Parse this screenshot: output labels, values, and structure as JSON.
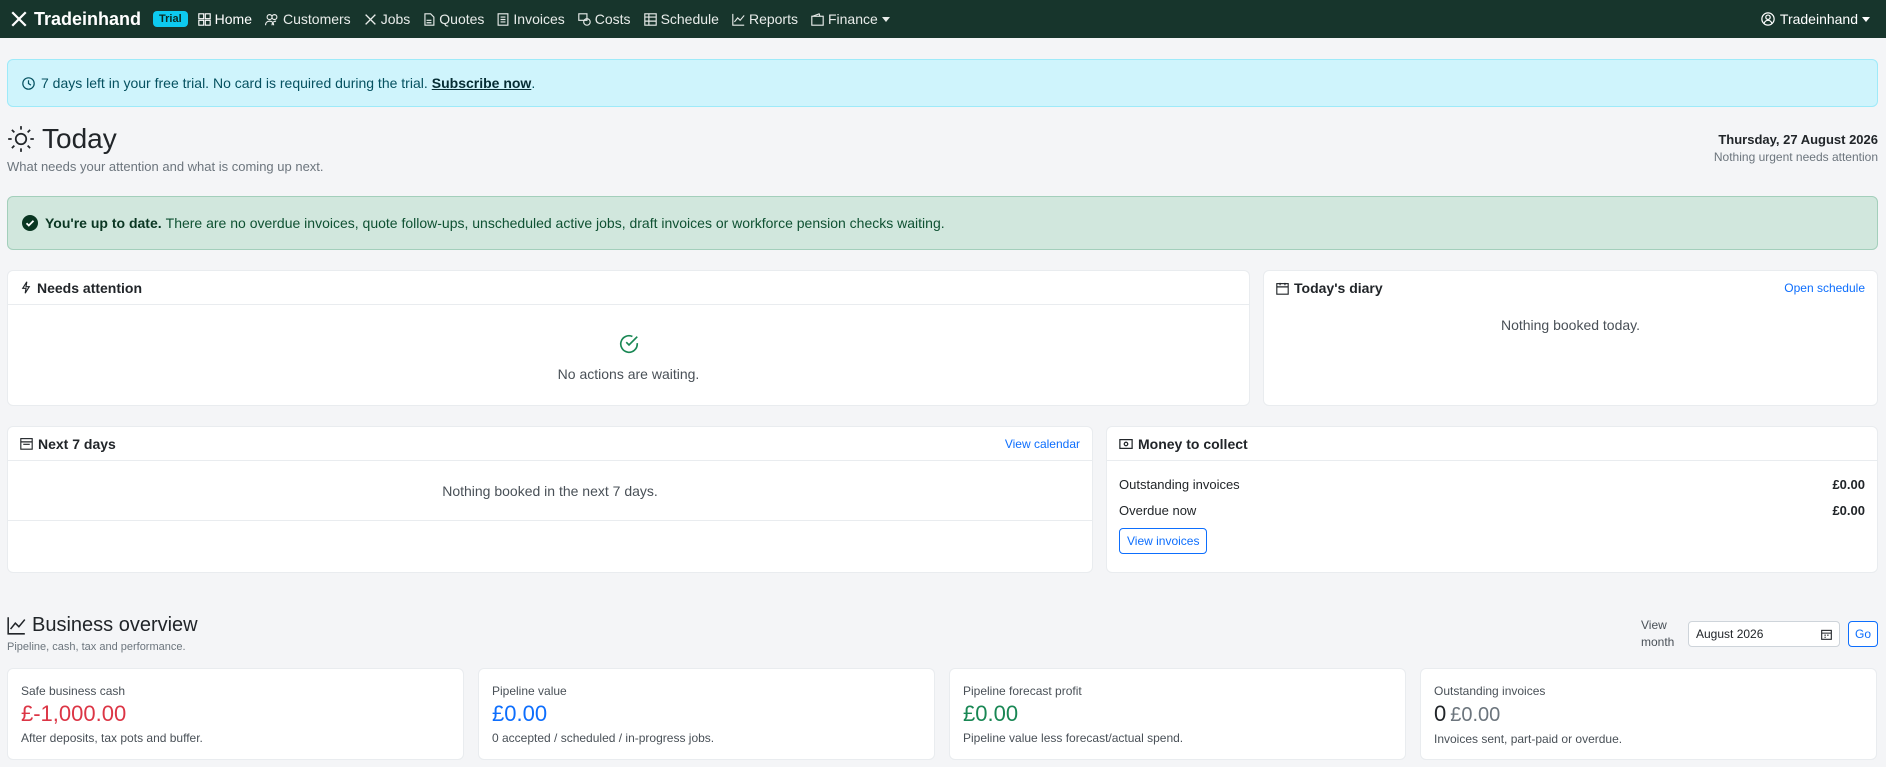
{
  "navbar": {
    "brand": "Tradeinhand",
    "trial_badge": "Trial",
    "items": [
      {
        "label": "Home",
        "icon": "grid-icon"
      },
      {
        "label": "Customers",
        "icon": "people-icon"
      },
      {
        "label": "Jobs",
        "icon": "tools-icon"
      },
      {
        "label": "Quotes",
        "icon": "document-icon"
      },
      {
        "label": "Invoices",
        "icon": "receipt-icon"
      },
      {
        "label": "Costs",
        "icon": "coins-icon"
      },
      {
        "label": "Schedule",
        "icon": "table-icon"
      },
      {
        "label": "Reports",
        "icon": "chart-line-icon"
      },
      {
        "label": "Finance",
        "icon": "wallet-icon"
      }
    ],
    "user": "Tradeinhand"
  },
  "trial_alert": {
    "text": "7 days left in your free trial. No card is required during the trial.",
    "link": "Subscribe now",
    "trailing": "."
  },
  "header": {
    "title": "Today",
    "subtitle": "What needs your attention and what is coming up next.",
    "date": "Thursday, 27 August 2026",
    "status": "Nothing urgent needs attention"
  },
  "success_alert": {
    "bold": "You're up to date.",
    "text": "There are no overdue invoices, quote follow-ups, unscheduled active jobs, draft invoices or workforce pension checks waiting."
  },
  "needs_attention": {
    "title": "Needs attention",
    "empty": "No actions are waiting."
  },
  "todays_diary": {
    "title": "Today's diary",
    "link": "Open schedule",
    "empty": "Nothing booked today."
  },
  "next_7_days": {
    "title": "Next 7 days",
    "link": "View calendar",
    "empty": "Nothing booked in the next 7 days."
  },
  "money_to_collect": {
    "title": "Money to collect",
    "rows": [
      {
        "label": "Outstanding invoices",
        "value": "£0.00"
      },
      {
        "label": "Overdue now",
        "value": "£0.00"
      }
    ],
    "button": "View invoices"
  },
  "business_overview": {
    "title": "Business overview",
    "subtitle": "Pipeline, cash, tax and performance.",
    "view_month_label_1": "View",
    "view_month_label_2": "month",
    "month_value": "August 2026",
    "go": "Go",
    "stats": [
      {
        "label": "Safe business cash",
        "value": "£-1,000.00",
        "note": "After deposits, tax pots and buffer.",
        "color": "#dc3545"
      },
      {
        "label": "Pipeline value",
        "value": "£0.00",
        "note": "0 accepted / scheduled / in-progress jobs.",
        "color": "#0d6efd"
      },
      {
        "label": "Pipeline forecast profit",
        "value": "£0.00",
        "note": "Pipeline value less forecast/actual spend.",
        "color": "#198754"
      },
      {
        "label": "Outstanding invoices",
        "value": "0",
        "value_secondary": "£0.00",
        "note": "Invoices sent, part-paid or overdue.",
        "color": "#212529"
      }
    ]
  }
}
